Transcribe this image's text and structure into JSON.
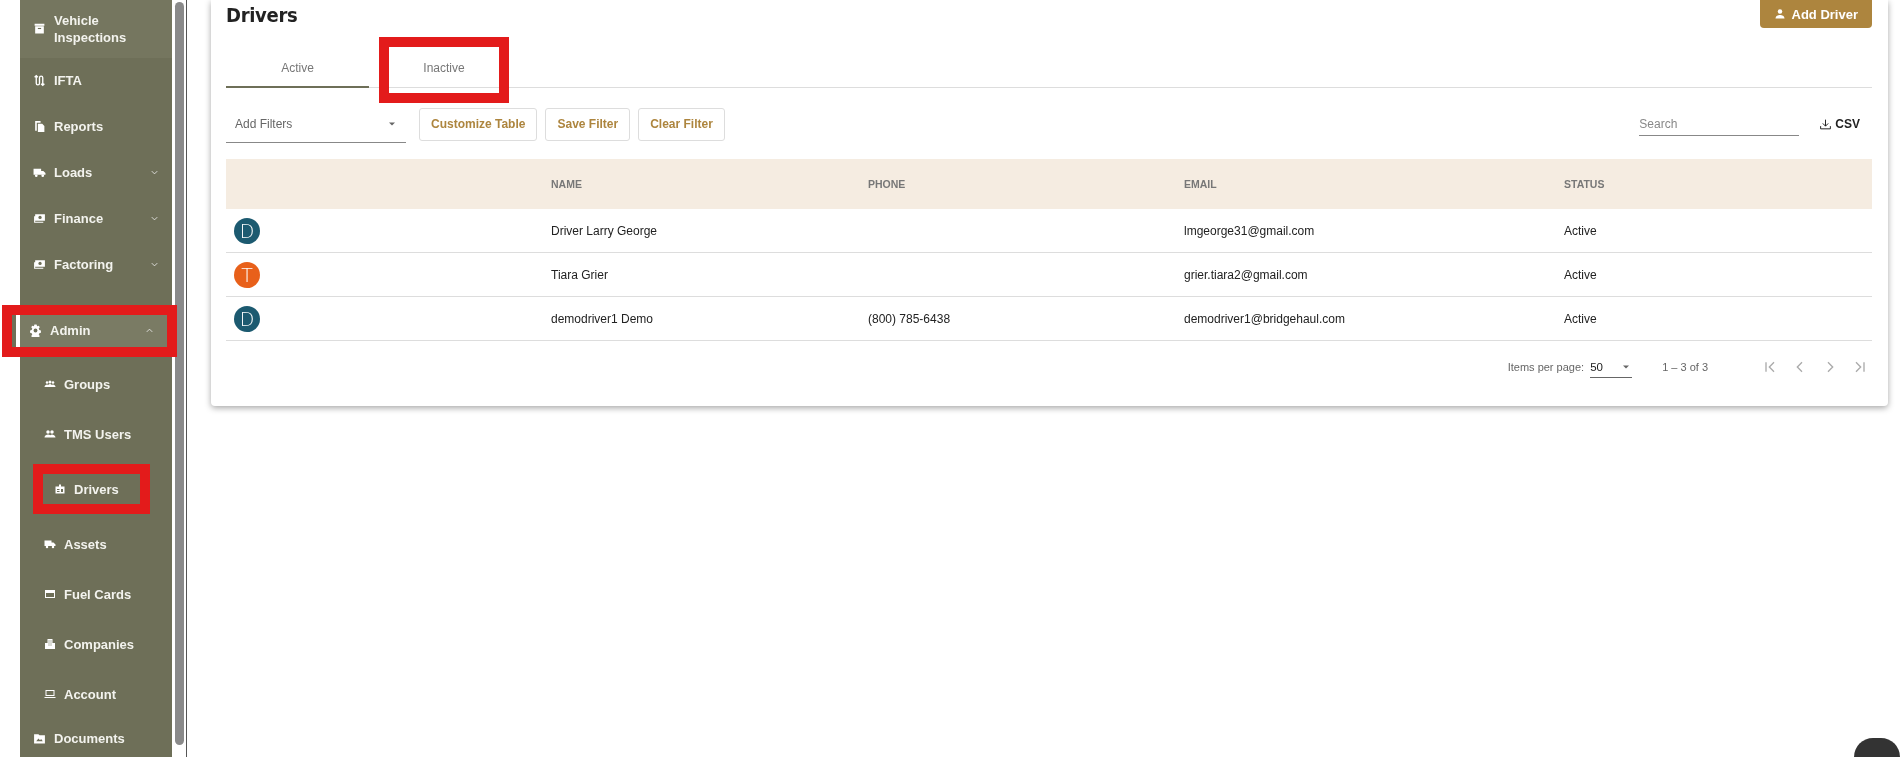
{
  "sidebar": {
    "items": [
      {
        "label": "Vehicle Inspections",
        "selected": false
      },
      {
        "label": "IFTA",
        "selected": false
      },
      {
        "label": "Reports",
        "selected": false
      },
      {
        "label": "Loads",
        "selected": false,
        "expanded": false
      },
      {
        "label": "Finance",
        "selected": false,
        "expanded": false
      },
      {
        "label": "Factoring",
        "selected": false,
        "expanded": false
      },
      {
        "label": "Admin",
        "selected": true,
        "highlighted": true,
        "expanded": true,
        "children": [
          {
            "label": "Groups"
          },
          {
            "label": "TMS Users"
          },
          {
            "label": "Drivers",
            "highlighted": true
          },
          {
            "label": "Assets"
          },
          {
            "label": "Fuel Cards"
          },
          {
            "label": "Companies"
          },
          {
            "label": "Account"
          }
        ]
      },
      {
        "label": "Documents",
        "selected": false
      }
    ]
  },
  "page": {
    "title": "Drivers",
    "add_button": "Add Driver",
    "tabs": [
      {
        "label": "Active",
        "selected": true
      },
      {
        "label": "Inactive",
        "selected": false,
        "highlighted": true
      }
    ],
    "filters": {
      "placeholder": "Add Filters"
    },
    "buttons": [
      "Customize Table",
      "Save Filter",
      "Clear Filter"
    ],
    "search": {
      "placeholder": "Search"
    },
    "export_button": "CSV",
    "table": {
      "columns": [
        "NAME",
        "PHONE",
        "EMAIL",
        "STATUS"
      ],
      "rows": [
        {
          "avatar": {
            "letter": "D",
            "color": "#1c5a70"
          },
          "name": "Driver Larry George",
          "email": "lmgeorge31@gmail.com",
          "status": "Active"
        },
        {
          "avatar": {
            "letter": "T",
            "color": "#e8601a"
          },
          "name": "Tiara Grier",
          "email": "grier.tiara2@gmail.com",
          "status": "Active"
        },
        {
          "avatar": {
            "letter": "D",
            "color": "#1c5a70"
          },
          "name": "demodriver1 Demo",
          "phone": "(800) 785-6438",
          "email": "demodriver1@bridgehaul.com",
          "status": "Active"
        }
      ]
    },
    "paginator": {
      "label": "Items per page:",
      "page_size": "50",
      "range": "1 – 3 of 3"
    }
  }
}
